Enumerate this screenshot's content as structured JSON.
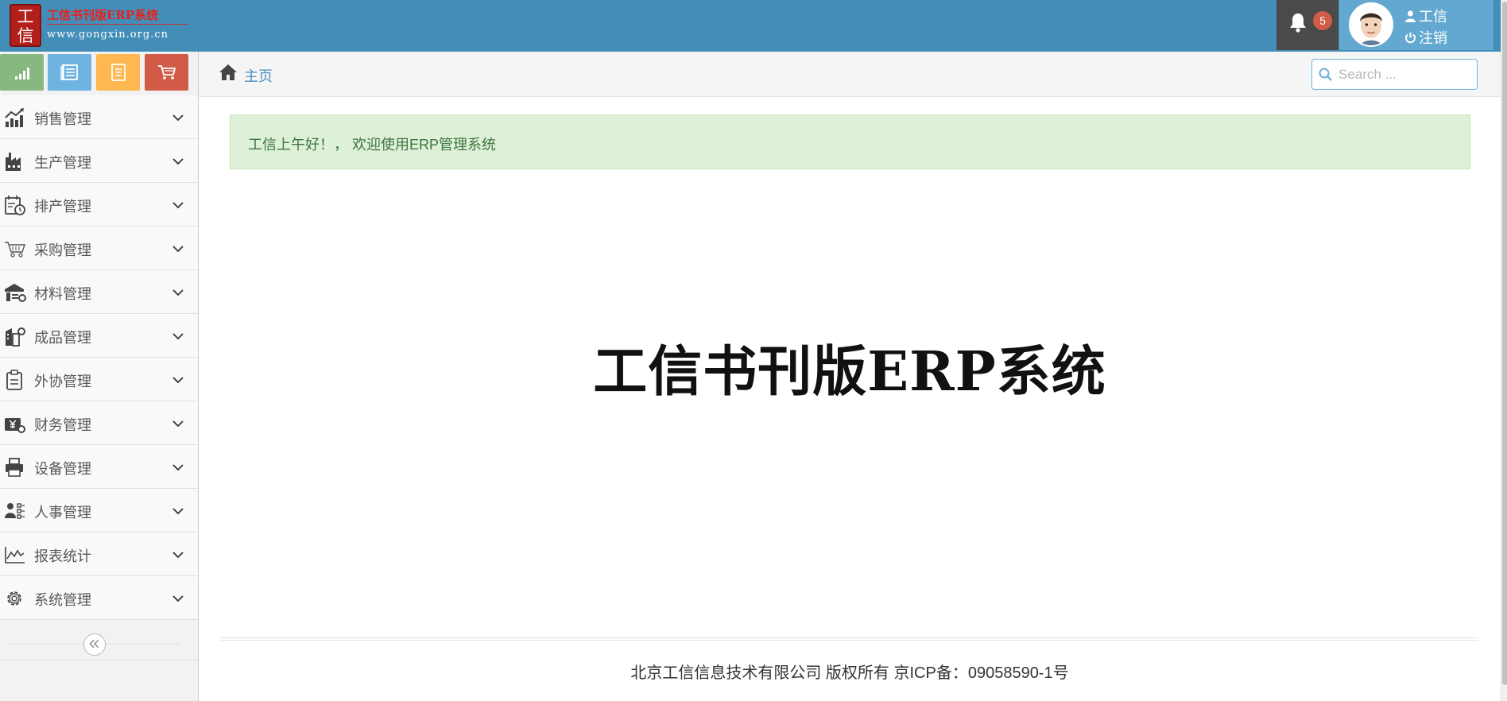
{
  "navbar": {
    "logo": {
      "seal_chars": "工信",
      "title": "工信书刊版ERP系统",
      "url": "www.gongxin.org.cn"
    },
    "notifications": {
      "count": "5",
      "icon": "bell-icon"
    },
    "user": {
      "name": "工信",
      "logout_label": "注销",
      "icon": "user-icon",
      "logout_icon": "power-icon"
    }
  },
  "colors": {
    "navbar": "#438eb9",
    "user_panel": "#62a8d1",
    "notif_panel": "#4a4a4a",
    "badge": "#d15b47",
    "shortcut_green": "#87b87f",
    "shortcut_blue": "#6fb3e0",
    "shortcut_orange": "#ffb752",
    "shortcut_red": "#d15b47",
    "alert_bg": "#dff0d8",
    "alert_text": "#3c763d"
  },
  "shortcuts": [
    {
      "name": "signal-icon",
      "color": "#87b87f"
    },
    {
      "name": "list-icon",
      "color": "#6fb3e0"
    },
    {
      "name": "document-icon",
      "color": "#ffb752"
    },
    {
      "name": "cart-icon",
      "color": "#d15b47"
    }
  ],
  "sidebar": {
    "items": [
      {
        "label": "销售管理",
        "icon": "sales-chart-icon"
      },
      {
        "label": "生产管理",
        "icon": "factory-icon"
      },
      {
        "label": "排产管理",
        "icon": "schedule-icon"
      },
      {
        "label": "采购管理",
        "icon": "purchase-cart-icon"
      },
      {
        "label": "材料管理",
        "icon": "warehouse-icon"
      },
      {
        "label": "成品管理",
        "icon": "product-building-icon"
      },
      {
        "label": "外协管理",
        "icon": "clipboard-icon"
      },
      {
        "label": "财务管理",
        "icon": "finance-icon"
      },
      {
        "label": "设备管理",
        "icon": "printer-icon"
      },
      {
        "label": "人事管理",
        "icon": "personnel-icon"
      },
      {
        "label": "报表统计",
        "icon": "line-chart-icon"
      },
      {
        "label": "系统管理",
        "icon": "gear-icon"
      }
    ],
    "collapse_icon": "double-chevron-left-icon"
  },
  "breadcrumbs": {
    "home_label": "主页",
    "home_icon": "home-icon"
  },
  "search": {
    "placeholder": "Search ...",
    "value": "",
    "icon": "search-icon"
  },
  "main": {
    "welcome": "工信上午好！， 欢迎使用ERP管理系统",
    "hero_title": "工信书刊版ERP系统"
  },
  "footer": {
    "text": "北京工信信息技术有限公司 版权所有 京ICP备：09058590-1号"
  }
}
